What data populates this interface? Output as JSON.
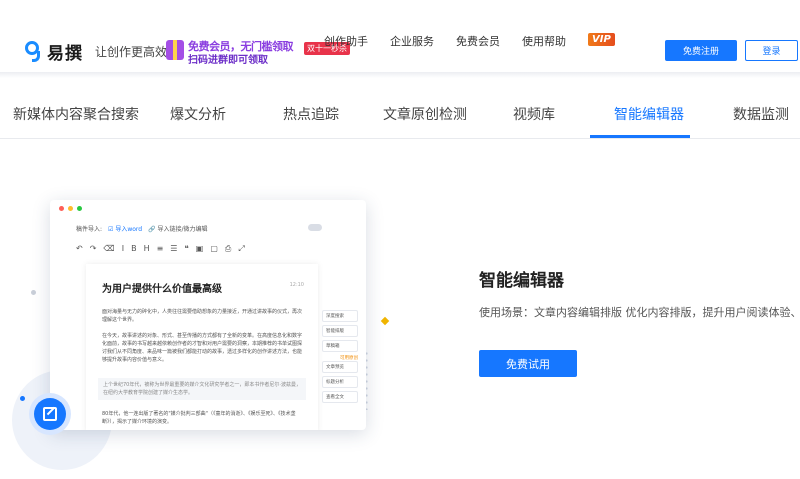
{
  "window": {
    "dot_colors": [
      "#fe5f57",
      "#febc2e",
      "#28c840"
    ]
  },
  "header": {
    "logo_name": "易撰",
    "slogan": "让创作更高效",
    "promo": {
      "line1": "免费会员，无门槛领取",
      "line2": "扫码进群即可领取",
      "badge": "双十一秒杀"
    },
    "nav": [
      "创作助手",
      "企业服务",
      "免费会员",
      "使用帮助"
    ],
    "vip": "VIP",
    "register_label": "免费注册",
    "login_label": "登录"
  },
  "tabs": {
    "items": [
      "新媒体内容聚合搜索",
      "爆文分析",
      "热点追踪",
      "文章原创检测",
      "视频库",
      "智能编辑器",
      "数据监测"
    ],
    "active_index": 5
  },
  "mock_editor": {
    "import_label": "稿件导入:",
    "import_word": "导入word",
    "import_link": "导入链接/微力编辑",
    "toolbar": [
      "↶",
      "↷",
      "⌫",
      "I",
      "B",
      "H",
      "≡",
      "☰",
      "❝",
      "▣",
      "▢",
      "⎙",
      "⤢"
    ],
    "doc_title": "为用户提供什么价值最高级",
    "doc_time": "12:10",
    "paragraphs": [
      "面对海量与无力的碎化中，人类往往需要借助想象的力量接近，开通过讲故事的仪式，再次理解这个世界。",
      "在今天，故事讲述的对象、形式、甚至传播的方式都有了全新的变革。在高度信息化和数字化面前，故事的书写越来越依赖创作者的才智和对用户需要的洞察，本期推荐的书单试图探讨我们从不同角度、来品味一篇被我们都能打动的故事，透过多样化的创作讲述方法，也能够提升故事内容价值与意义。"
    ],
    "quote": "上个世纪70年代，被称为世界最重要的媒介文化研究学者之一，即本书作者尼尔·波兹曼，在纽约大学教育学院创建了媒介生态学。",
    "tail": "80年代，他一连出版了著名的\"媒介批判三部曲\"（《童年的消逝》、《娱乐至死》、《技术垄断》），揭示了媒介环境的演变。",
    "side_tools": [
      "深度搜索",
      "智能排版",
      "草稿箱",
      "文章预览",
      "标题分析",
      "查看全文"
    ],
    "side_tag": "可用原创"
  },
  "feature": {
    "title": "智能编辑器",
    "description": "使用场景：文章内容编辑排版 优化内容排版，提升用户阅读体验、提",
    "cta": "免费试用"
  },
  "colors": {
    "accent": "#1677ff",
    "vip": "#f07a1a"
  }
}
